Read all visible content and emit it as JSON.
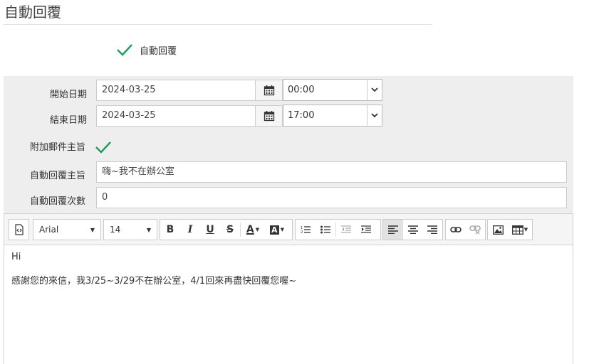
{
  "page": {
    "title": "自動回覆"
  },
  "enable": {
    "label": "自動回覆",
    "checked": true,
    "icon": "checkmark-icon"
  },
  "form": {
    "start": {
      "label": "開始日期",
      "date": "2024-03-25",
      "time": "00:00"
    },
    "end": {
      "label": "結束日期",
      "date": "2024-03-25",
      "time": "17:00"
    },
    "attach_subject": {
      "label": "附加郵件主旨",
      "checked": true
    },
    "subject": {
      "label": "自動回覆主旨",
      "value": "嗨~我不在辦公室"
    },
    "count": {
      "label": "自動回覆次數",
      "value": "0"
    }
  },
  "toolbar": {
    "font_name": "Arial",
    "font_size": "14",
    "bold": "B",
    "italic": "I",
    "underline": "U",
    "strike": "S",
    "font_color": "A",
    "bg_color": "A"
  },
  "editor": {
    "lines": [
      "Hi",
      "感謝您的來信，我3/25~3/29不在辦公室，4/1回來再盡快回覆您喔~"
    ]
  },
  "colors": {
    "check_green": "#1a9e5c",
    "panel_bg": "#eeeeee"
  }
}
